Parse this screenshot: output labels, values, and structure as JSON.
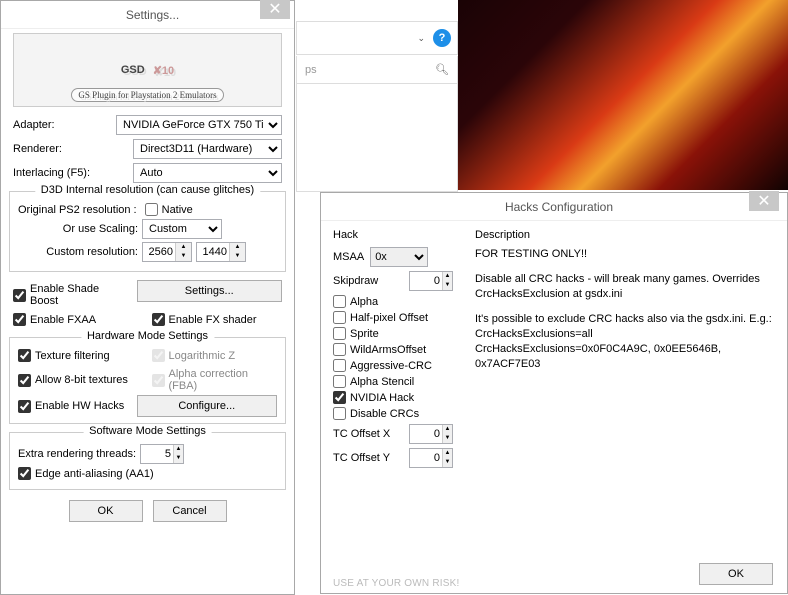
{
  "settings": {
    "title": "Settings...",
    "adapter_label": "Adapter:",
    "adapter_value": "NVIDIA GeForce GTX 750 Ti",
    "renderer_label": "Renderer:",
    "renderer_value": "Direct3D11 (Hardware)",
    "interlacing_label": "Interlacing (F5):",
    "interlacing_value": "Auto",
    "d3d_group": "D3D Internal resolution (can cause glitches)",
    "orig_res_label": "Original PS2 resolution :",
    "native_label": "Native",
    "scaling_label": "Or use Scaling:",
    "scaling_value": "Custom",
    "custom_res_label": "Custom resolution:",
    "res_w": "2560",
    "res_h": "1440",
    "shade_boost": "Enable Shade Boost",
    "shade_settings_btn": "Settings...",
    "fxaa": "Enable FXAA",
    "fx_shader": "Enable FX shader",
    "hw_group": "Hardware Mode Settings",
    "tex_filter": "Texture filtering",
    "log_z": "Logarithmic Z",
    "allow_8bit": "Allow 8-bit textures",
    "alpha_corr": "Alpha correction (FBA)",
    "hw_hacks": "Enable HW Hacks",
    "configure_btn": "Configure...",
    "sw_group": "Software Mode Settings",
    "threads_label": "Extra rendering threads:",
    "threads_value": "5",
    "edge_aa": "Edge anti-aliasing (AA1)",
    "ok": "OK",
    "cancel": "Cancel"
  },
  "bg": {
    "search_placeholder": "ps",
    "help": "?"
  },
  "hacks": {
    "title": "Hacks Configuration",
    "hack_head": "Hack",
    "desc_head": "Description",
    "msaa_label": "MSAA",
    "msaa_value": "0x",
    "skipdraw_label": "Skipdraw",
    "skipdraw_value": "0",
    "alpha": "Alpha",
    "halfpixel": "Half-pixel Offset",
    "sprite": "Sprite",
    "wildarms": "WildArmsOffset",
    "aggressive": "Aggressive-CRC",
    "alphastencil": "Alpha Stencil",
    "nvidia": "NVIDIA Hack",
    "disable_crcs": "Disable CRCs",
    "tc_x_label": "TC Offset X",
    "tc_x_value": "0",
    "tc_y_label": "TC Offset Y",
    "tc_y_value": "0",
    "desc1": "FOR TESTING ONLY!!",
    "desc2": "Disable all CRC hacks - will break many games. Overrides CrcHacksExclusion at gsdx.ini",
    "desc3": "It's possible to exclude CRC hacks also via the gsdx.ini. E.g.:",
    "desc4": "CrcHacksExclusions=all",
    "desc5": "CrcHacksExclusions=0x0F0C4A9C, 0x0EE5646B, 0x7ACF7E03",
    "risk": "USE AT YOUR OWN RISK!",
    "ok": "OK"
  }
}
